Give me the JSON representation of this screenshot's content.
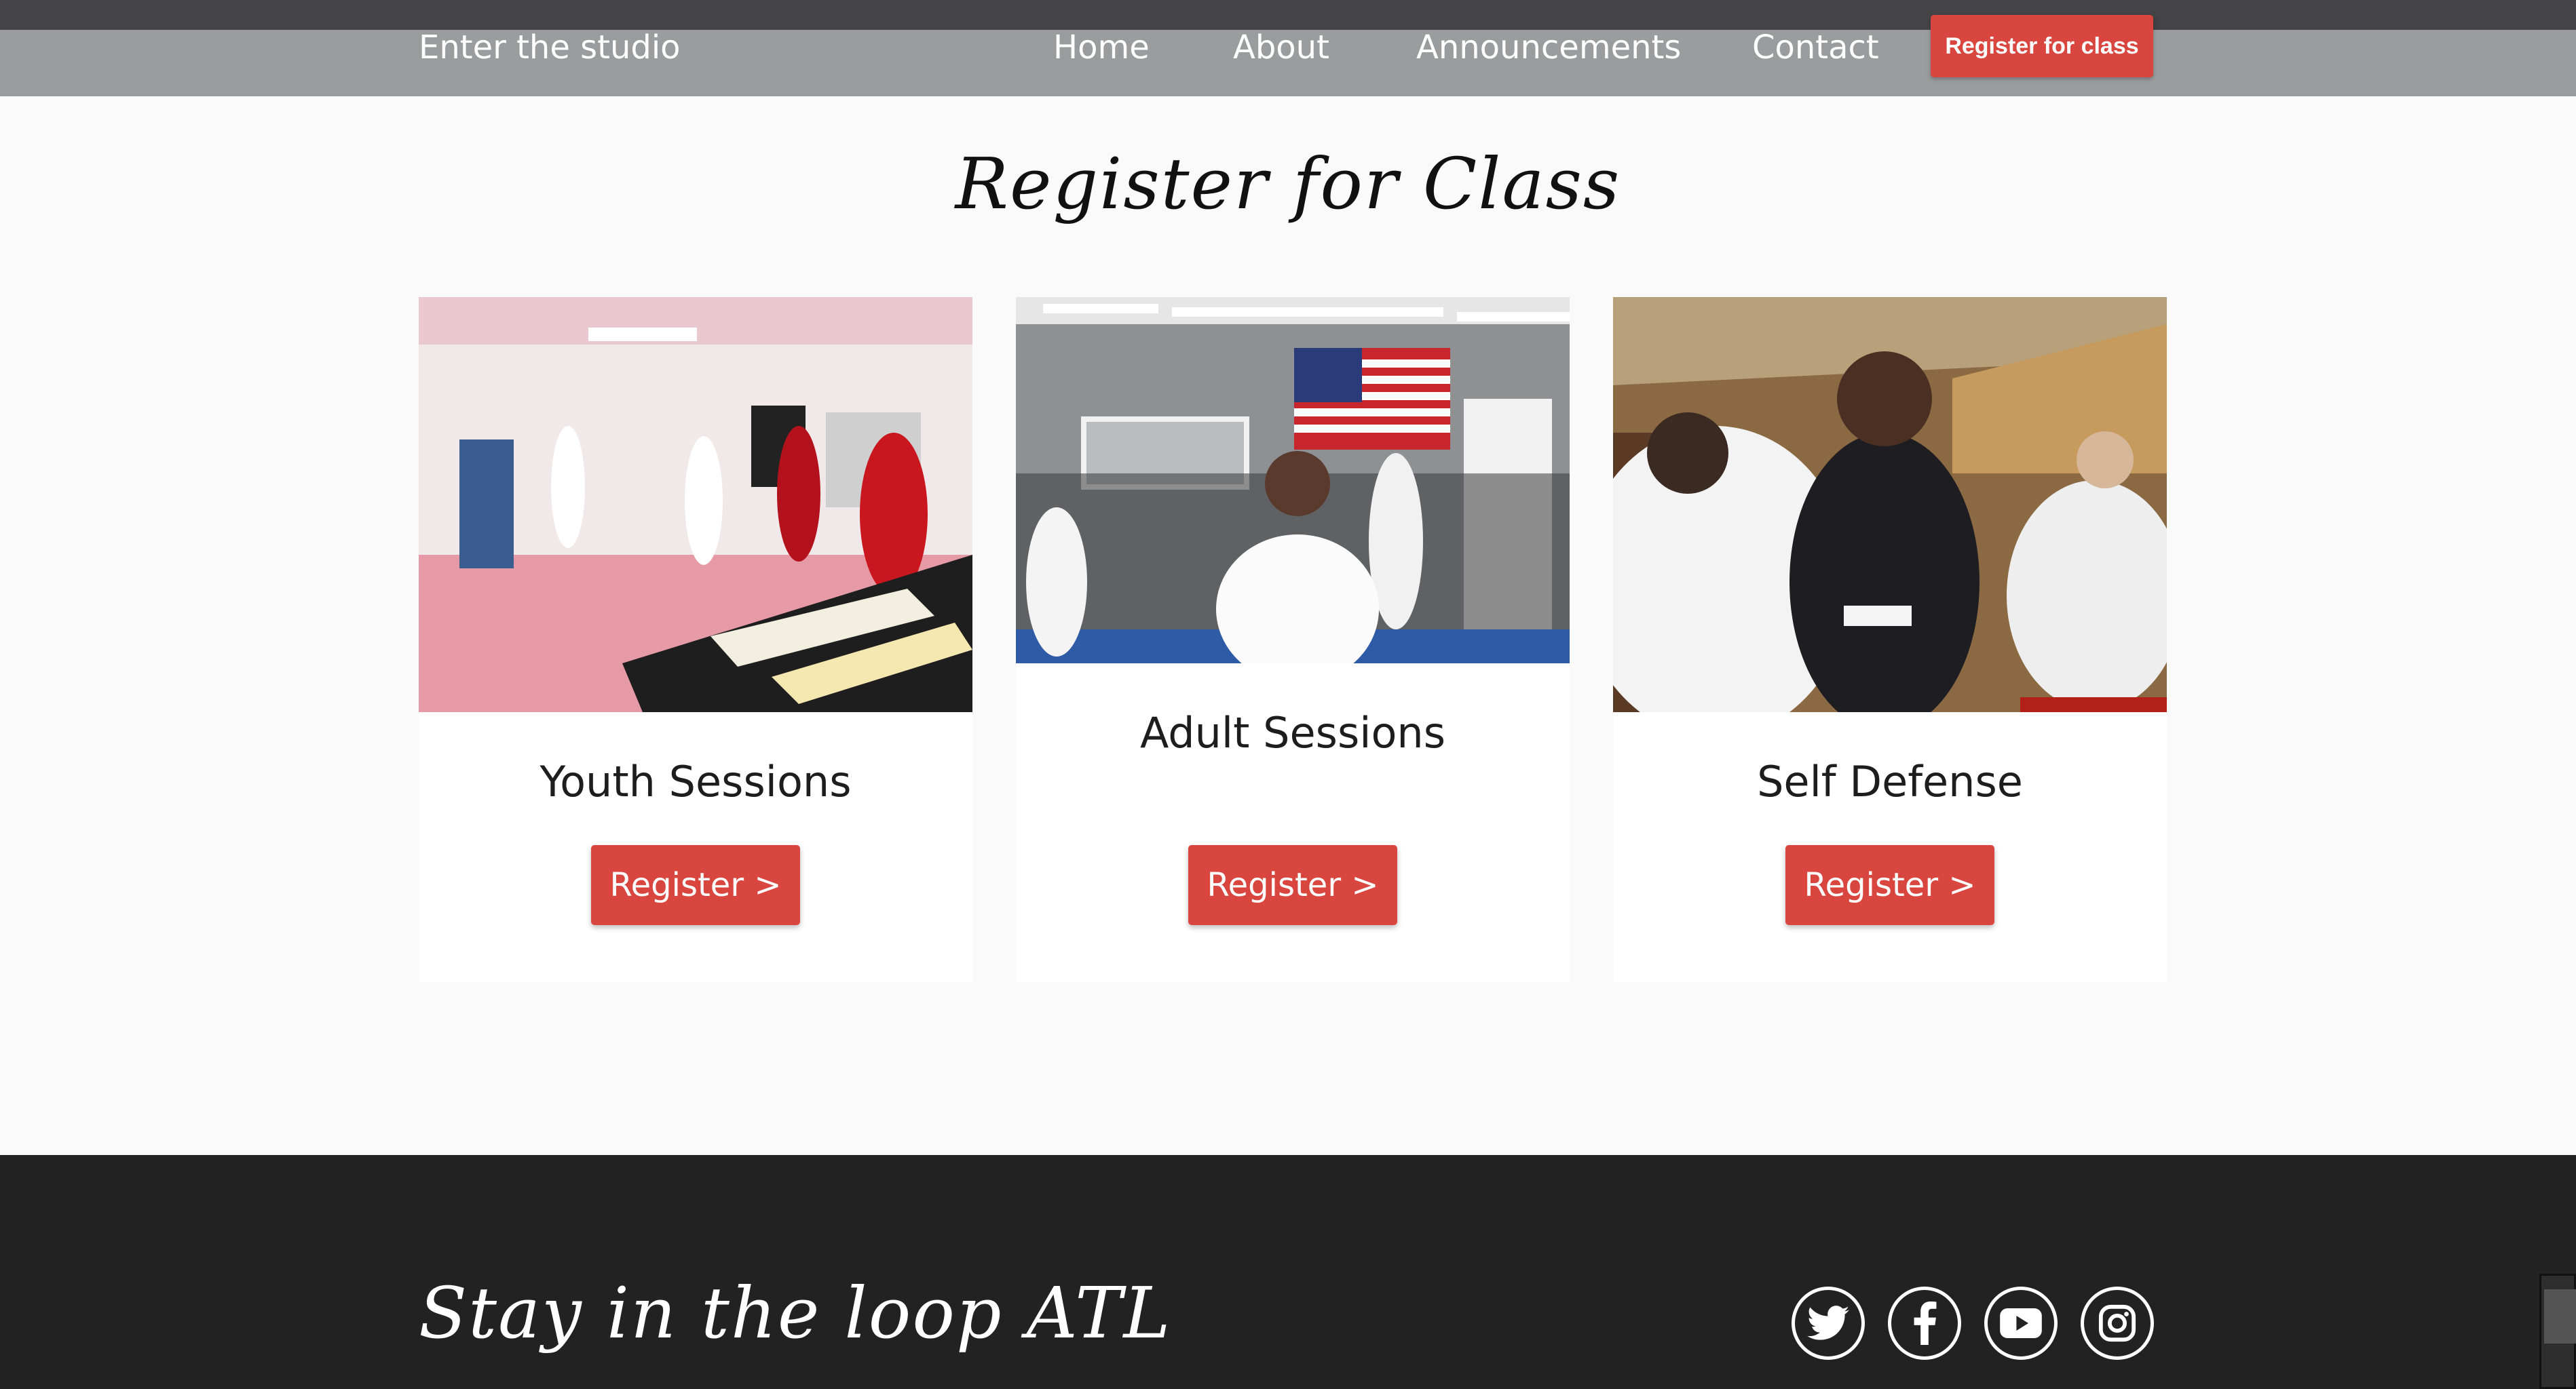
{
  "header": {
    "brand": "Enter the studio",
    "nav": [
      "Home",
      "About",
      "Announcements",
      "Contact"
    ],
    "cta_label": "Register for class"
  },
  "main": {
    "title": "Register for Class",
    "cards": [
      {
        "title": "Youth Sessions",
        "button": "Register >"
      },
      {
        "title": "Adult Sessions",
        "button": "Register >"
      },
      {
        "title": "Self Defense",
        "button": "Register >"
      }
    ]
  },
  "footer": {
    "heading": "Stay in the loop ATL",
    "social_icons": [
      "twitter-icon",
      "facebook-icon",
      "youtube-icon",
      "instagram-icon"
    ]
  },
  "colors": {
    "accent": "#d9463f",
    "navbar": "#9b9c9e",
    "footer": "#222222"
  }
}
